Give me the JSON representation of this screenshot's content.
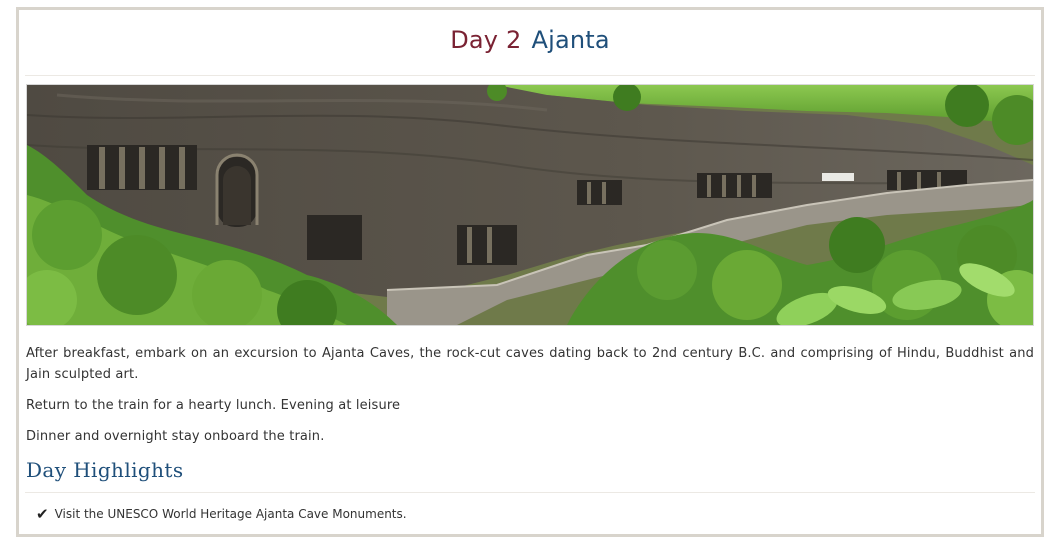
{
  "header": {
    "day_label": "Day 2",
    "place_label": "Ajanta"
  },
  "image": {
    "subject": "Ajanta rock-cut caves on a cliff surrounded by green vegetation"
  },
  "paragraphs": [
    "After breakfast, embark on an excursion to Ajanta Caves, the rock-cut caves dating back to 2nd century B.C. and comprising of Hindu, Buddhist and Jain sculpted art.",
    "Return to the train for a hearty lunch. Evening at leisure",
    "Dinner and overnight stay onboard the train."
  ],
  "highlights": {
    "heading": "Day Highlights",
    "items": [
      {
        "icon": "checkmark-icon",
        "text": "Visit the UNESCO World Heritage Ajanta Cave Monuments."
      }
    ]
  },
  "colors": {
    "day_label": "#7a2233",
    "place_label": "#1f4f7a",
    "heading": "#1f4f7a",
    "frame_border": "#d8d4cc"
  }
}
